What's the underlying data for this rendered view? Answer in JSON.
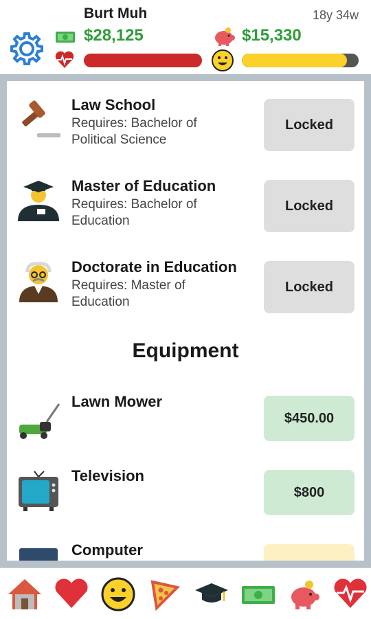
{
  "header": {
    "name": "Burt Muh",
    "age": "18y 34w",
    "cash": "$28,125",
    "savings": "$15,330",
    "health_level": 1.0,
    "happiness_level": 0.9,
    "colors": {
      "money": "#2e9d3a",
      "health": "#cc2a2a",
      "happiness": "#fcd12a"
    }
  },
  "education": [
    {
      "title": "Law School",
      "requirement": "Requires: Bachelor of Political Science",
      "button": "Locked",
      "icon": "gavel-icon"
    },
    {
      "title": "Master of Education",
      "requirement": "Requires: Bachelor of Education",
      "button": "Locked",
      "icon": "graduate-icon"
    },
    {
      "title": "Doctorate in Education",
      "requirement": "Requires: Master of Education",
      "button": "Locked",
      "icon": "professor-icon"
    }
  ],
  "equipment_section": {
    "title": "Equipment"
  },
  "equipment": [
    {
      "title": "Lawn Mower",
      "price": "$450.00",
      "icon": "lawn-mower-icon"
    },
    {
      "title": "Television",
      "price": "$800",
      "icon": "television-icon"
    },
    {
      "title": "Computer",
      "price": "",
      "icon": "computer-icon"
    }
  ],
  "nav": [
    "home-icon",
    "heart-icon",
    "smiley-icon",
    "pizza-icon",
    "graduation-cap-icon",
    "money-icon",
    "piggy-bank-icon",
    "health-icon"
  ]
}
